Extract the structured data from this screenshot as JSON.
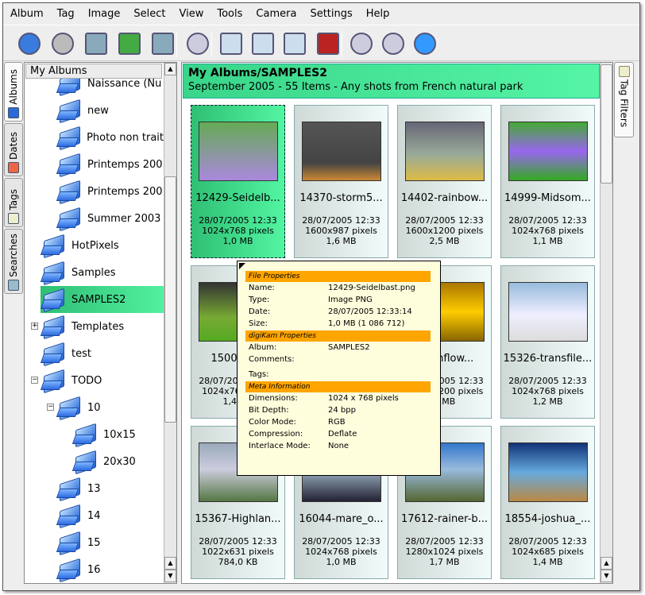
{
  "menu": [
    "Album",
    "Tag",
    "Image",
    "Select",
    "View",
    "Tools",
    "Camera",
    "Settings",
    "Help"
  ],
  "toolbar": [
    {
      "icon": "back-icon",
      "c": "#3a7be0"
    },
    {
      "icon": "forward-icon",
      "c": "#bbb"
    },
    {
      "icon": "new-album-icon",
      "c": "#8ab"
    },
    {
      "icon": "import-icon",
      "c": "#4a4"
    },
    {
      "icon": "edit-album-icon",
      "c": "#8ab"
    },
    {
      "icon": "search-icon",
      "c": "#ccd"
    },
    {
      "icon": "view-image-icon",
      "c": "#cde"
    },
    {
      "icon": "edit-image-icon",
      "c": "#cde"
    },
    {
      "icon": "image-properties-icon",
      "c": "#cde"
    },
    {
      "icon": "pencil-icon",
      "c": "#b22"
    },
    {
      "icon": "zoom-in-icon",
      "c": "#ccd"
    },
    {
      "icon": "zoom-out-icon",
      "c": "#ccd"
    },
    {
      "icon": "fullscreen-icon",
      "c": "#39f"
    }
  ],
  "left_tabs": [
    {
      "label": "Albums",
      "c": "#2a6ad8"
    },
    {
      "label": "Dates",
      "c": "#e64"
    },
    {
      "label": "Tags",
      "c": "#eec"
    },
    {
      "label": "Searches",
      "c": "#9bc"
    }
  ],
  "right_tab": {
    "label": "Tag Filters"
  },
  "tree": {
    "header": "My Albums",
    "items": [
      {
        "label": "Naissance (Nu",
        "level": 2
      },
      {
        "label": "new",
        "level": 2
      },
      {
        "label": "Photo non trait",
        "level": 2
      },
      {
        "label": "Printemps 200",
        "level": 2
      },
      {
        "label": "Printemps 200",
        "level": 2
      },
      {
        "label": "Summer 2003",
        "level": 2
      },
      {
        "label": "HotPixels",
        "level": 1
      },
      {
        "label": "Samples",
        "level": 1
      },
      {
        "label": "SAMPLES2",
        "level": 1,
        "selected": true
      },
      {
        "label": "Templates",
        "level": 1,
        "expander": "+"
      },
      {
        "label": "test",
        "level": 1
      },
      {
        "label": "TODO",
        "level": 1,
        "expander": "-"
      },
      {
        "label": "10",
        "level": 2,
        "expander": "-"
      },
      {
        "label": "10x15",
        "level": 3
      },
      {
        "label": "20x30",
        "level": 3
      },
      {
        "label": "13",
        "level": 2
      },
      {
        "label": "14",
        "level": 2
      },
      {
        "label": "15",
        "level": 2
      },
      {
        "label": "16",
        "level": 2
      }
    ]
  },
  "main": {
    "title": "My Albums/SAMPLES2",
    "subtitle": "September 2005 - 55 Items - Any shots from French natural park",
    "items": [
      {
        "name": "12429-Seidelb...",
        "date": "28/07/2005 12:33",
        "dims": "1024x768 pixels",
        "size": "1,0 MB",
        "selected": true,
        "g": "#6a5 , #a8d"
      },
      {
        "name": "14370-storm5...",
        "date": "28/07/2005 12:33",
        "dims": "1600x987 pixels",
        "size": "1,6 MB",
        "g": "#555 , #444 70%, #c83"
      },
      {
        "name": "14402-rainbow...",
        "date": "28/07/2005 12:33",
        "dims": "1600x1200 pixels",
        "size": "2,5 MB",
        "g": "#667 , #9a9 55%, #db4"
      },
      {
        "name": "14999-Midsom...",
        "date": "28/07/2005 12:33",
        "dims": "1024x768 pixels",
        "size": "1,1 MB",
        "g": "#4a3 , #96e 50%, #3a2"
      },
      {
        "name": "15000-U...",
        "date": "28/07/2005 12:33",
        "dims": "1024x768 pixels",
        "size": "1,4 MB",
        "g": "#333 , #7a3 60%, #5a2"
      },
      {
        "name": "",
        "date": "",
        "dims": "",
        "size": "",
        "g": "#444 , #666"
      },
      {
        "name": "...sunflow...",
        "date": "28/07/2005 12:33",
        "dims": "1600x1200 pixels",
        "size": "...MB",
        "g": "#a70 , #fc0 50%, #860"
      },
      {
        "name": "15326-transfile...",
        "date": "28/07/2005 12:33",
        "dims": "1024x768 pixels",
        "size": "1,2 MB",
        "g": "#9bd , #eef 55%, #ddd"
      },
      {
        "name": "15367-Highlan...",
        "date": "28/07/2005 12:33",
        "dims": "1022x631 pixels",
        "size": "784,0 KB",
        "g": "#9ab , #ccd 45%, #574"
      },
      {
        "name": "16044-mare_o...",
        "date": "28/07/2005 12:33",
        "dims": "1024x768 pixels",
        "size": "1,0 MB",
        "g": "#112 , #89a 55%, #223"
      },
      {
        "name": "17612-rainer-b...",
        "date": "28/07/2005 12:33",
        "dims": "1280x1024 pixels",
        "size": "1,7 MB",
        "g": "#37c , #9bd 45%, #563"
      },
      {
        "name": "18554-joshua_...",
        "date": "28/07/2005 12:33",
        "dims": "1024x685 pixels",
        "size": "1,4 MB",
        "g": "#137 , #6ad 50%, #b84"
      }
    ]
  },
  "tooltip": {
    "sections": [
      {
        "title": "File Properties",
        "rows": [
          [
            "Name:",
            "12429-Seidelbast.png"
          ],
          [
            "Type:",
            "Image PNG"
          ],
          [
            "Date:",
            "28/07/2005 12:33:14"
          ],
          [
            "Size:",
            "1,0 MB (1 086 712)"
          ]
        ]
      },
      {
        "title": "digiKam Properties",
        "rows": [
          [
            "Album:",
            "SAMPLES2"
          ],
          [
            "Comments:",
            ""
          ],
          [
            "Tags:",
            ""
          ]
        ]
      },
      {
        "title": "Meta Information",
        "rows": [
          [
            "Dimensions:",
            "1024 x 768 pixels"
          ],
          [
            "Bit Depth:",
            "24 bpp"
          ],
          [
            "Color Mode:",
            "RGB"
          ],
          [
            "Compression:",
            "Deflate"
          ],
          [
            "Interlace Mode:",
            "None"
          ]
        ]
      }
    ]
  },
  "colors": {
    "selection": "#3ddc8c",
    "tooltip_section": "#ffa500",
    "tooltip_bg": "#fefedd"
  }
}
